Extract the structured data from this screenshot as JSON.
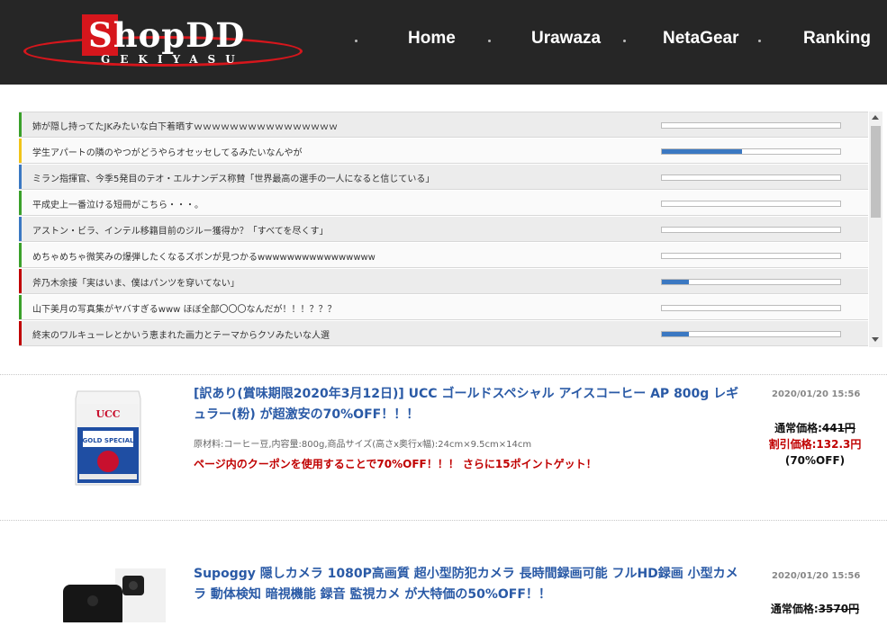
{
  "header": {
    "logo_text": "ShopDD",
    "logo_sub": "GEKIYASU",
    "nav": [
      "Home",
      "Urawaza",
      "NetaGear",
      "Ranking"
    ]
  },
  "news": [
    {
      "title": "姉が隠し持ってたJKみたいな白下着晒すｗｗｗｗｗｗｗｗｗｗｗｗｗｗｗｗ",
      "color": "#3aa02a",
      "level": 0
    },
    {
      "title": "学生アパートの隣のやつがどうやらオセッセしてるみたいなんやが",
      "color": "#f0c419",
      "level": 0.45
    },
    {
      "title": "ミラン指揮官、今季5発目のテオ・エルナンデス称賛「世界最高の選手の一人になると信じている」",
      "color": "#3b78c2",
      "level": 0
    },
    {
      "title": "平成史上一番泣ける短冊がこちら・・・。",
      "color": "#3aa02a",
      "level": 0
    },
    {
      "title": "アストン・ビラ、インテル移籍目前のジルー獲得か？「すべてを尽くす」",
      "color": "#3b78c2",
      "level": 0
    },
    {
      "title": "めちゃめちゃ微笑みの爆弾したくなるズボンが見つかるwwwwwwwwwwwwwwww",
      "color": "#3aa02a",
      "level": 0
    },
    {
      "title": "斧乃木余接「実はいま、僕はパンツを穿いてない」",
      "color": "#c00000",
      "level": 0.15
    },
    {
      "title": "山下美月の写真集がヤバすぎるwww ほぼ全部〇〇〇なんだが！！！？？？",
      "color": "#3aa02a",
      "level": 0
    },
    {
      "title": "終末のワルキューレとかいう恵まれた画力とテーマからクソみたいな人選",
      "color": "#c00000",
      "level": 0.15
    }
  ],
  "products": [
    {
      "title": "[訳あり(賞味期限2020年3月12日)] UCC ゴールドスペシャル アイスコーヒー AP 800g レギュラー(粉) が超激安の70%OFF！！！",
      "date": "2020/01/20 15:56",
      "spec": "原材料:コーヒー豆,内容量:800g,商品サイズ(高さx奥行x幅):24cm×9.5cm×14cm",
      "coupon": "ページ内のクーポンを使用することで70%OFF！！！ さらに15ポイントゲット！",
      "regular_label": "通常価格:",
      "regular_price": "441円",
      "sale_label": "割引価格:",
      "sale_price": "132.3円",
      "off": "(70%OFF)",
      "brand": "UCC",
      "package_text": "GOLD SPECIAL"
    },
    {
      "title": "Supoggy 隠しカメラ 1080P高画質 超小型防犯カメラ 長時間録画可能 フルHD録画 小型カメラ 動体検知 暗視機能 録音 監視カメ が大特価の50%OFF！！",
      "date": "2020/01/20 15:56",
      "regular_label": "通常価格:",
      "regular_price": "3570円"
    }
  ],
  "colors": {
    "header_bg": "#262626",
    "brand_red": "#d6161c",
    "link_blue": "#2a5aa6",
    "sale_red": "#c00000"
  }
}
